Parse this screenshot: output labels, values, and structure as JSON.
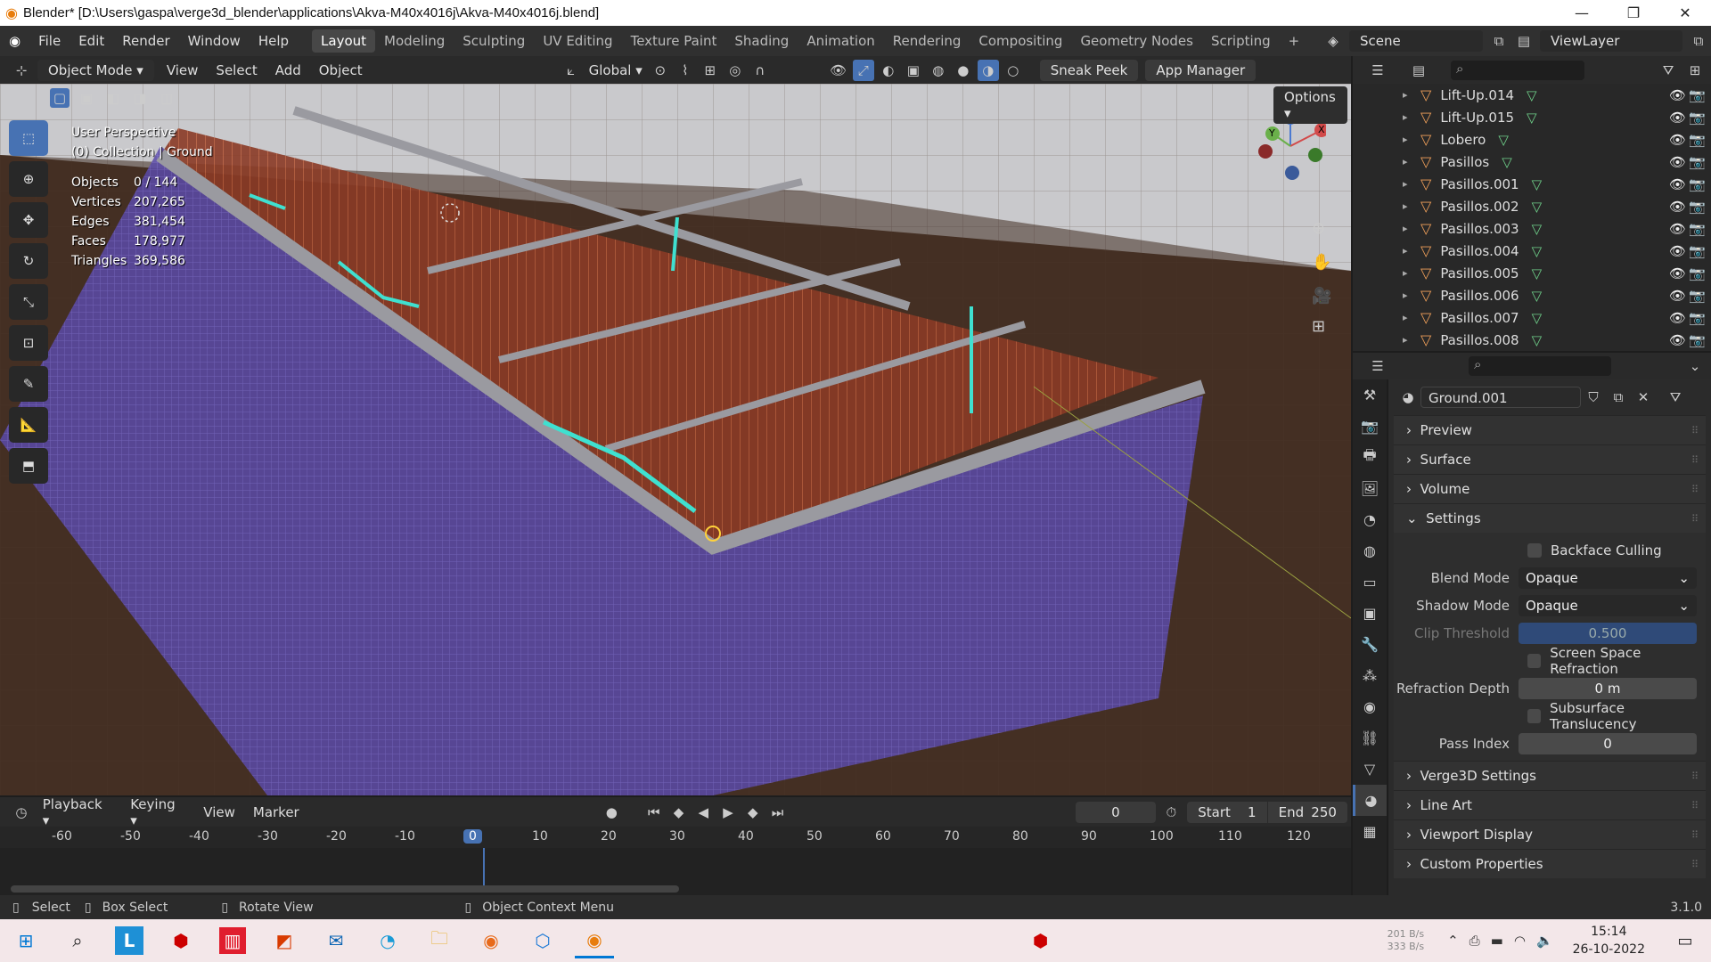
{
  "titlebar": {
    "title": "Blender* [D:\\Users\\gaspa\\verge3d_blender\\applications\\Akva-M40x4016j\\Akva-M40x4016j.blend]"
  },
  "menu": {
    "items": [
      "File",
      "Edit",
      "Render",
      "Window",
      "Help"
    ]
  },
  "workspaces": {
    "tabs": [
      "Layout",
      "Modeling",
      "Sculpting",
      "UV Editing",
      "Texture Paint",
      "Shading",
      "Animation",
      "Rendering",
      "Compositing",
      "Geometry Nodes",
      "Scripting"
    ],
    "active": "Layout",
    "add": "+"
  },
  "scene": {
    "label": "Scene",
    "viewlayer": "ViewLayer"
  },
  "header3d": {
    "mode": "Object Mode",
    "menus": [
      "View",
      "Select",
      "Add",
      "Object"
    ],
    "orientation": "Global",
    "sneak_peek": "Sneak Peek",
    "app_manager": "App Manager",
    "options": "Options"
  },
  "overlay": {
    "perspective": "User Perspective",
    "collection": "(0) Collection | Ground",
    "stats": [
      {
        "k": "Objects",
        "v": "0 / 144"
      },
      {
        "k": "Vertices",
        "v": "207,265"
      },
      {
        "k": "Edges",
        "v": "381,454"
      },
      {
        "k": "Faces",
        "v": "178,977"
      },
      {
        "k": "Triangles",
        "v": "369,586"
      }
    ]
  },
  "gizmo": {
    "x": "X",
    "y": "Y",
    "z": "Z"
  },
  "timeline": {
    "menus": [
      "Playback",
      "Keying",
      "View",
      "Marker"
    ],
    "current_frame": "0",
    "start_label": "Start",
    "start": "1",
    "end_label": "End",
    "end": "250",
    "ticks": [
      "-60",
      "-50",
      "-40",
      "-30",
      "-20",
      "-10",
      "0",
      "10",
      "20",
      "30",
      "40",
      "50",
      "60",
      "70",
      "80",
      "90",
      "100",
      "110",
      "120"
    ]
  },
  "statusbar": {
    "select": "Select",
    "box_select": "Box Select",
    "rotate": "Rotate View",
    "context": "Object Context Menu",
    "version": "3.1.0"
  },
  "outliner": {
    "items": [
      "Lift-Up.014",
      "Lift-Up.015",
      "Lobero",
      "Pasillos",
      "Pasillos.001",
      "Pasillos.002",
      "Pasillos.003",
      "Pasillos.004",
      "Pasillos.005",
      "Pasillos.006",
      "Pasillos.007",
      "Pasillos.008"
    ]
  },
  "material": {
    "name": "Ground.001",
    "panels_top": [
      "Preview",
      "Surface",
      "Volume"
    ],
    "settings": "Settings",
    "backface_culling": "Backface Culling",
    "blend_mode_label": "Blend Mode",
    "blend_mode": "Opaque",
    "shadow_mode_label": "Shadow Mode",
    "shadow_mode": "Opaque",
    "clip_label": "Clip Threshold",
    "clip": "0.500",
    "ssr": "Screen Space Refraction",
    "refraction_label": "Refraction Depth",
    "refraction": "0 m",
    "subsurface": "Subsurface Translucency",
    "pass_label": "Pass Index",
    "pass": "0",
    "panels_bottom": [
      "Verge3D Settings",
      "Line Art",
      "Viewport Display",
      "Custom Properties"
    ]
  },
  "taskbar": {
    "net_up": "201 B/s",
    "net_down": "333 B/s",
    "time": "15:14",
    "date": "26-10-2022"
  }
}
